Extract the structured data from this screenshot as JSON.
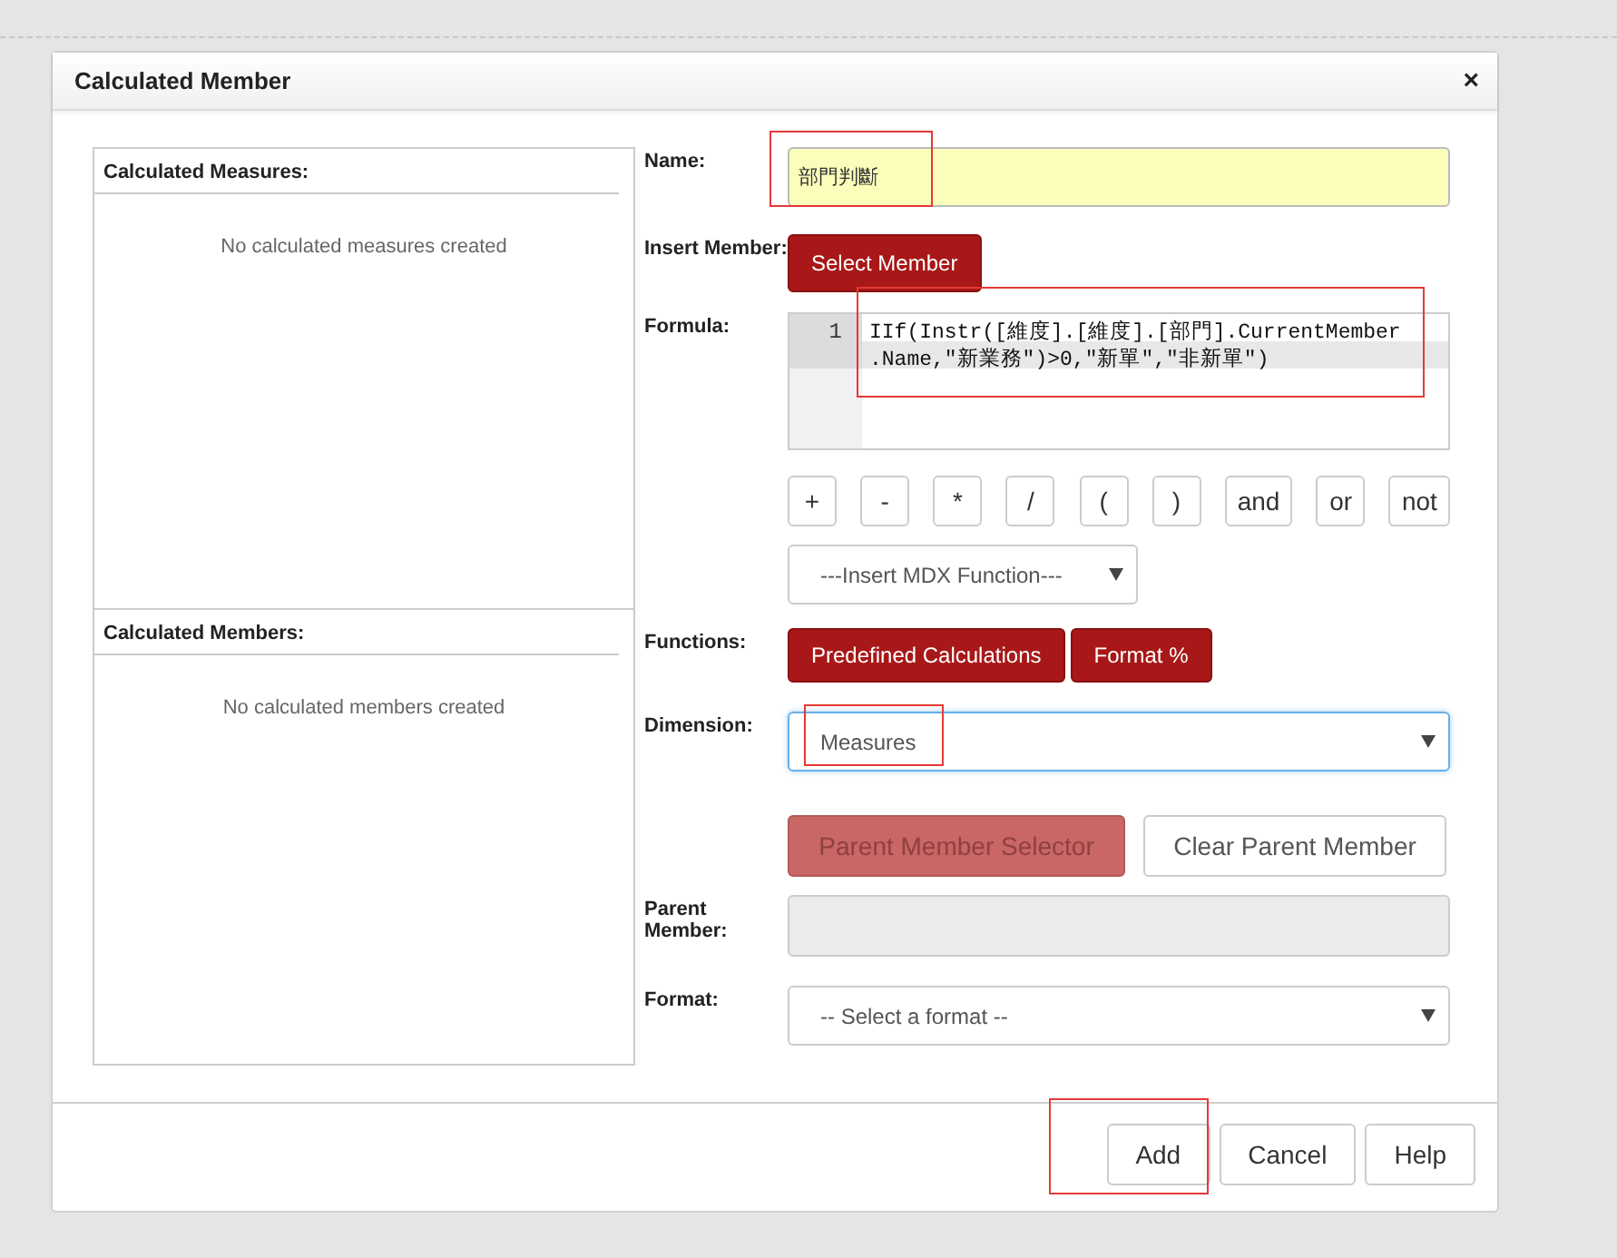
{
  "dialog": {
    "title": "Calculated Member",
    "close": "×"
  },
  "lists": [
    {
      "heading": "Calculated Measures:",
      "empty_text": "No calculated measures created"
    },
    {
      "heading": "Calculated Members:",
      "empty_text": "No calculated members created"
    }
  ],
  "form": {
    "name": {
      "label": "Name:",
      "value": "部門判斷"
    },
    "insert_member": {
      "label": "Insert Member:",
      "button": "Select Member"
    },
    "formula": {
      "label": "Formula:",
      "line_number": "1",
      "lines": [
        {
          "text": "IIf(Instr([維度].[維度].[部門].CurrentMember",
          "active": false
        },
        {
          "text": ".Name,\"新業務\")>0,\"新單\",\"非新單\")",
          "active": true
        }
      ]
    },
    "operators": [
      "+",
      "-",
      "*",
      "/",
      "(",
      ")",
      "and",
      "or",
      "not"
    ],
    "mdx_function": {
      "value": "---Insert MDX Function---"
    },
    "functions": {
      "label": "Functions:",
      "buttons": [
        "Predefined Calculations",
        "Format %"
      ]
    },
    "dimension": {
      "label": "Dimension:",
      "value": "Measures",
      "focused": true
    },
    "parent_buttons": [
      {
        "label": "Parent Member Selector",
        "disabled": true,
        "kind": "primary"
      },
      {
        "label": "Clear Parent Member",
        "disabled": false,
        "kind": "default"
      }
    ],
    "parent_member": {
      "label": "Parent Member:",
      "disabled": true
    },
    "format": {
      "label": "Format:",
      "value": "-- Select a format --"
    }
  },
  "buttons": [
    "Add",
    "Cancel",
    "Help"
  ]
}
